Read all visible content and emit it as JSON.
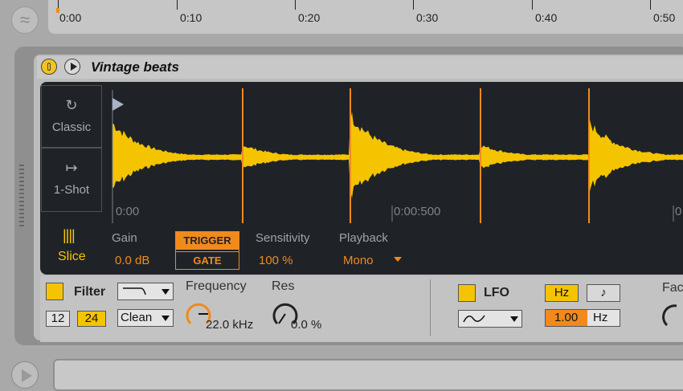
{
  "timeline": {
    "ticks": [
      "0:00",
      "0:10",
      "0:20",
      "0:30",
      "0:40",
      "0:50"
    ]
  },
  "device": {
    "title": "Vintage beats"
  },
  "display": {
    "modes": {
      "classic": "Classic",
      "oneshot": "1-Shot",
      "slice": "Slice"
    },
    "time_labels": [
      "0:00",
      "0:00:500",
      "0"
    ],
    "gain": {
      "label": "Gain",
      "value": "0.0 dB"
    },
    "trigger_label": "TRIGGER",
    "gate_label": "GATE",
    "sensitivity": {
      "label": "Sensitivity",
      "value": "100 %"
    },
    "playback": {
      "label": "Playback",
      "value": "Mono"
    }
  },
  "controls": {
    "filter": {
      "label": "Filter",
      "slope_12": "12",
      "slope_24": "24",
      "type_value": "Clean",
      "frequency_label": "Frequency",
      "frequency_value": "22.0 kHz",
      "res_label": "Res",
      "res_value": "0.0 %"
    },
    "lfo": {
      "label": "LFO",
      "hz_button": "Hz",
      "rate_value": "1.00",
      "rate_unit": "Hz"
    },
    "partial_label": "Fac"
  },
  "colors": {
    "accent_orange": "#f08a1c",
    "accent_yellow": "#f5c400",
    "display_bg": "#1f2328",
    "waveform": "#f5c400"
  },
  "icons": {
    "classic": "loop-icon",
    "oneshot": "arrow-to-bar-icon",
    "slice": "slice-bars-icon"
  }
}
